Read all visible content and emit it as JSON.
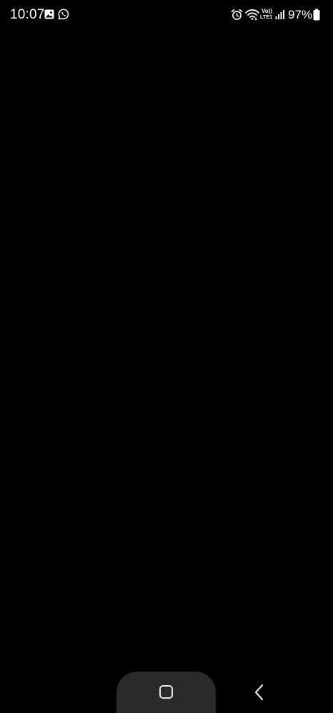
{
  "status_bar": {
    "time": "10:07",
    "volte_top": "Vo))",
    "volte_bottom": "LTE1",
    "battery_percent": "97%",
    "notification_icons": [
      "gallery-icon",
      "whatsapp-icon"
    ],
    "system_icons": [
      "alarm-icon",
      "wifi-icon",
      "volte-lte-icon",
      "signal-icon",
      "battery-icon"
    ]
  },
  "navigation_bar": {
    "buttons": [
      "home-button",
      "back-button"
    ]
  },
  "colors": {
    "background": "#000000",
    "foreground": "#ffffff",
    "home_pill": "#2a2a2a"
  }
}
